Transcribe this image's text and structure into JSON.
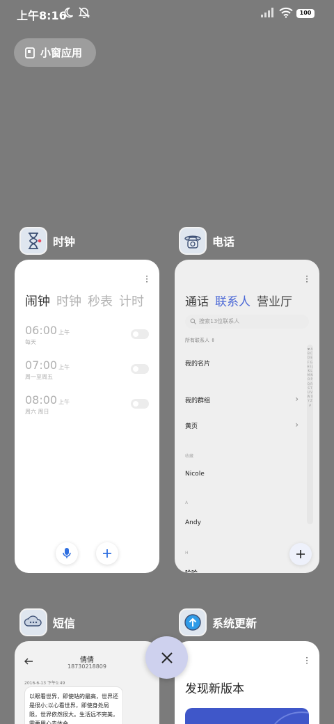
{
  "status_bar": {
    "time": "上午8:16",
    "battery": "100"
  },
  "floating_window": {
    "label": "小窗应用"
  },
  "cards": {
    "clock": {
      "app_name": "时钟",
      "tabs": [
        "闹钟",
        "时钟",
        "秒表",
        "计时"
      ],
      "alarms": [
        {
          "time": "06:00",
          "ampm": "上午",
          "repeat": "每天"
        },
        {
          "time": "07:00",
          "ampm": "上午",
          "repeat": "周一至周五"
        },
        {
          "time": "08:00",
          "ampm": "上午",
          "repeat": "周六 周日"
        }
      ]
    },
    "phone": {
      "app_name": "电话",
      "tabs": [
        "通话",
        "联系人",
        "营业厅"
      ],
      "search_placeholder": "搜索13位联系人",
      "all_contacts": "所有联系人",
      "my_card": "我的名片",
      "my_groups": "我的群组",
      "yellow_pages": "黄页",
      "favorites_header": "收藏",
      "favorite_contact": "Nicole",
      "section_a": "A",
      "contact_a": "Andy",
      "section_h": "H",
      "contact_h_partial": "哈哈",
      "index_letters": "♥ A B C D E F G H I J K L M N O P Q R S T U V W X Y Z #"
    },
    "messages": {
      "app_name": "短信",
      "contact_name": "倩倩",
      "contact_number": "18730218809",
      "date": "2016-6-13 下午1:49",
      "message_text": "以眼看世界，即使站的最高，世界还是很小;以心看世界，即使身处局限，世界依然很大。生活远不完美，需要用心去体会"
    },
    "system_update": {
      "app_name": "系统更新",
      "title": "发现新版本"
    }
  }
}
